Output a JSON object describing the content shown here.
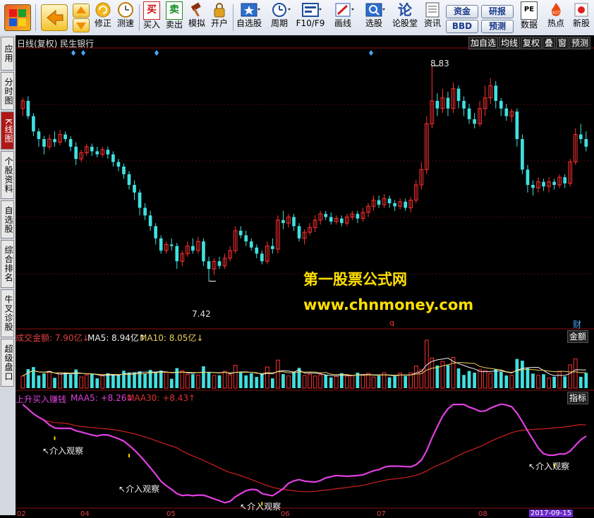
{
  "toolbar": {
    "buttons": [
      {
        "label": "修正",
        "icon": "refresh-icon"
      },
      {
        "label": "测速",
        "icon": "clock-icon"
      },
      {
        "label": "买入",
        "icon": "buy-icon"
      },
      {
        "label": "卖出",
        "icon": "sell-icon"
      },
      {
        "label": "模拟",
        "icon": "gavel-icon"
      },
      {
        "label": "开户",
        "icon": "lock-icon"
      },
      {
        "label": "自选股",
        "icon": "star-icon"
      },
      {
        "label": "周期",
        "icon": "period-icon"
      },
      {
        "label": "F10/F9",
        "icon": "f10-icon"
      },
      {
        "label": "画线",
        "icon": "pen-icon"
      },
      {
        "label": "选股",
        "icon": "screen-icon"
      },
      {
        "label": "论股堂",
        "icon": "forum-icon"
      },
      {
        "label": "资讯",
        "icon": "news-icon"
      },
      {
        "label": "数据",
        "icon": "pe-icon"
      },
      {
        "label": "热点",
        "icon": "hot-icon"
      },
      {
        "label": "新股",
        "icon": "ipo-icon"
      }
    ],
    "small_buttons": [
      "资金",
      "研报",
      "BBD",
      "预测"
    ],
    "colors": {
      "accent_red": "#b01818",
      "bg": "#000000"
    }
  },
  "sidebar": {
    "tabs": [
      "应用",
      "分时图",
      "K线图",
      "个股资料",
      "自选股",
      "综合排名",
      "牛叉诊股",
      "超级盘口"
    ],
    "active": "K线图"
  },
  "chart_header": {
    "title": "日线(复权)  民生银行",
    "right_buttons": [
      "加自选",
      "均线",
      "复权",
      "叠",
      "窗",
      "预测"
    ]
  },
  "chart_data": [
    {
      "type": "candlestick",
      "title": "日线(复权) 民生银行",
      "ylim": [
        7.2,
        8.9
      ],
      "annotations": [
        {
          "label": "8.83",
          "note": "high"
        },
        {
          "label": "7.42",
          "note": "low"
        },
        {
          "label": "财",
          "note": "finance marker"
        }
      ],
      "x_ticks": [
        "02",
        "04",
        "05",
        "06",
        "07",
        "08",
        "2017-09-15"
      ],
      "candles": [
        [
          8.55,
          8.6,
          8.62,
          8.5
        ],
        [
          8.6,
          8.5,
          8.63,
          8.48
        ],
        [
          8.5,
          8.4,
          8.52,
          8.37
        ],
        [
          8.4,
          8.35,
          8.42,
          8.3
        ],
        [
          8.35,
          8.3,
          8.37,
          8.25
        ],
        [
          8.3,
          8.35,
          8.38,
          8.28
        ],
        [
          8.35,
          8.33,
          8.4,
          8.3
        ],
        [
          8.33,
          8.38,
          8.41,
          8.31
        ],
        [
          8.38,
          8.35,
          8.4,
          8.33
        ],
        [
          8.35,
          8.3,
          8.37,
          8.27
        ],
        [
          8.3,
          8.22,
          8.33,
          8.18
        ],
        [
          8.22,
          8.26,
          8.28,
          8.2
        ],
        [
          8.26,
          8.3,
          8.32,
          8.24
        ],
        [
          8.3,
          8.27,
          8.32,
          8.24
        ],
        [
          8.27,
          8.25,
          8.3,
          8.23
        ],
        [
          8.25,
          8.28,
          8.3,
          8.23
        ],
        [
          8.28,
          8.25,
          8.3,
          8.22
        ],
        [
          8.25,
          8.2,
          8.27,
          8.17
        ],
        [
          8.2,
          8.17,
          8.22,
          8.14
        ],
        [
          8.17,
          8.12,
          8.19,
          8.09
        ],
        [
          8.12,
          8.05,
          8.14,
          8.02
        ],
        [
          8.05,
          8.0,
          8.08,
          7.95
        ],
        [
          8.0,
          7.9,
          8.02,
          7.85
        ],
        [
          7.9,
          7.85,
          7.93,
          7.82
        ],
        [
          7.85,
          7.78,
          7.88,
          7.75
        ],
        [
          7.78,
          7.7,
          7.8,
          7.66
        ],
        [
          7.7,
          7.62,
          7.72,
          7.6
        ],
        [
          7.62,
          7.66,
          7.68,
          7.6
        ],
        [
          7.66,
          7.65,
          7.7,
          7.62
        ],
        [
          7.65,
          7.55,
          7.67,
          7.5
        ],
        [
          7.55,
          7.6,
          7.62,
          7.52
        ],
        [
          7.6,
          7.65,
          7.68,
          7.58
        ],
        [
          7.65,
          7.62,
          7.7,
          7.6
        ],
        [
          7.62,
          7.68,
          7.71,
          7.6
        ],
        [
          7.68,
          7.55,
          7.7,
          7.52
        ],
        [
          7.55,
          7.5,
          7.58,
          7.42
        ],
        [
          7.5,
          7.55,
          7.57,
          7.46
        ],
        [
          7.55,
          7.52,
          7.58,
          7.5
        ],
        [
          7.52,
          7.57,
          7.6,
          7.5
        ],
        [
          7.57,
          7.62,
          7.65,
          7.55
        ],
        [
          7.62,
          7.75,
          7.78,
          7.6
        ],
        [
          7.75,
          7.72,
          7.78,
          7.7
        ],
        [
          7.72,
          7.68,
          7.75,
          7.65
        ],
        [
          7.68,
          7.64,
          7.7,
          7.62
        ],
        [
          7.64,
          7.6,
          7.66,
          7.57
        ],
        [
          7.6,
          7.55,
          7.62,
          7.53
        ],
        [
          7.55,
          7.65,
          7.68,
          7.53
        ],
        [
          7.65,
          7.63,
          7.7,
          7.6
        ],
        [
          7.63,
          7.82,
          7.85,
          7.6
        ],
        [
          7.82,
          7.8,
          7.88,
          7.76
        ],
        [
          7.8,
          7.84,
          7.86,
          7.77
        ],
        [
          7.84,
          7.78,
          7.86,
          7.75
        ],
        [
          7.78,
          7.7,
          7.8,
          7.68
        ],
        [
          7.7,
          7.74,
          7.76,
          7.66
        ],
        [
          7.74,
          7.77,
          7.8,
          7.72
        ],
        [
          7.77,
          7.82,
          7.85,
          7.74
        ],
        [
          7.82,
          7.86,
          7.88,
          7.79
        ],
        [
          7.86,
          7.84,
          7.88,
          7.82
        ],
        [
          7.84,
          7.81,
          7.87,
          7.79
        ],
        [
          7.81,
          7.83,
          7.85,
          7.79
        ],
        [
          7.83,
          7.8,
          7.85,
          7.78
        ],
        [
          7.8,
          7.84,
          7.86,
          7.78
        ],
        [
          7.84,
          7.86,
          7.88,
          7.82
        ],
        [
          7.86,
          7.83,
          7.88,
          7.8
        ],
        [
          7.83,
          7.87,
          7.9,
          7.81
        ],
        [
          7.87,
          7.91,
          7.93,
          7.84
        ],
        [
          7.91,
          7.95,
          7.98,
          7.88
        ],
        [
          7.95,
          7.92,
          7.98,
          7.9
        ],
        [
          7.92,
          7.96,
          7.99,
          7.9
        ],
        [
          7.96,
          7.93,
          7.98,
          7.9
        ],
        [
          7.93,
          7.91,
          7.95,
          7.88
        ],
        [
          7.91,
          7.94,
          7.96,
          7.89
        ],
        [
          7.94,
          7.9,
          7.96,
          7.88
        ],
        [
          7.9,
          7.95,
          7.97,
          7.87
        ],
        [
          7.95,
          8.05,
          8.08,
          7.93
        ],
        [
          8.05,
          8.15,
          8.2,
          8.02
        ],
        [
          8.15,
          8.45,
          8.5,
          8.12
        ],
        [
          8.45,
          8.6,
          8.83,
          8.42
        ],
        [
          8.6,
          8.55,
          8.65,
          8.5
        ],
        [
          8.55,
          8.62,
          8.68,
          8.52
        ],
        [
          8.62,
          8.55,
          8.66,
          8.5
        ],
        [
          8.55,
          8.68,
          8.72,
          8.52
        ],
        [
          8.68,
          8.6,
          8.7,
          8.55
        ],
        [
          8.6,
          8.55,
          8.63,
          8.5
        ],
        [
          8.55,
          8.48,
          8.58,
          8.45
        ],
        [
          8.48,
          8.45,
          8.52,
          8.42
        ],
        [
          8.45,
          8.55,
          8.6,
          8.43
        ],
        [
          8.55,
          8.62,
          8.7,
          8.5
        ],
        [
          8.62,
          8.7,
          8.75,
          8.58
        ],
        [
          8.7,
          8.6,
          8.73,
          8.55
        ],
        [
          8.6,
          8.55,
          8.62,
          8.5
        ],
        [
          8.55,
          8.5,
          8.58,
          8.47
        ],
        [
          8.5,
          8.53,
          8.55,
          8.46
        ],
        [
          8.53,
          8.35,
          8.55,
          8.3
        ],
        [
          8.35,
          8.15,
          8.38,
          8.12
        ],
        [
          8.15,
          8.05,
          8.18,
          8.0
        ],
        [
          8.05,
          8.03,
          8.08,
          7.98
        ],
        [
          8.03,
          8.07,
          8.1,
          8.0
        ],
        [
          8.07,
          8.04,
          8.09,
          8.01
        ],
        [
          8.04,
          8.07,
          8.1,
          8.0
        ],
        [
          8.07,
          8.05,
          8.09,
          8.02
        ],
        [
          8.05,
          8.1,
          8.12,
          8.03
        ],
        [
          8.1,
          8.06,
          8.12,
          8.03
        ],
        [
          8.06,
          8.2,
          8.22,
          8.04
        ],
        [
          8.2,
          8.38,
          8.42,
          8.18
        ],
        [
          8.38,
          8.35,
          8.45,
          8.32
        ],
        [
          8.35,
          8.3,
          8.4,
          8.27
        ]
      ]
    },
    {
      "type": "bar",
      "title": "成交金额",
      "unit": "亿",
      "series": [
        {
          "name": "成交金额",
          "last": "7.90亿"
        },
        {
          "name": "MA5",
          "last": "8.94亿"
        },
        {
          "name": "MA10",
          "last": "8.05亿"
        }
      ]
    },
    {
      "type": "line",
      "title": "上升买入赚钱",
      "series": [
        {
          "name": "MAA5",
          "last": "+8.26"
        },
        {
          "name": "MAA30",
          "last": "+8.43"
        }
      ],
      "annotations": [
        "介入观察",
        "介入观察",
        "介入观察",
        "介入观察"
      ]
    }
  ],
  "indicator_labels": {
    "volume_title": "成交金额: 7.90亿↓",
    "volume_ma5": "MA5: 8.94亿↑",
    "volume_ma10": "MA10: 8.05亿↓",
    "volume_right": "金额",
    "ind_title": "上升买入赚钱",
    "ind_maa5": "MAA5: +8.26↓",
    "ind_maa30": "MAA30: +8.43↑",
    "ind_right": "指标",
    "high_label": "8.83",
    "low_label": "7.42",
    "finance_marker": "财",
    "q_marker": "q",
    "signal_label": "介入观察"
  },
  "x_axis": {
    "ticks": [
      "02",
      "04",
      "05",
      "06",
      "07",
      "08"
    ],
    "date": "2017-09-15"
  },
  "watermark": {
    "line1": "第一股票公式网",
    "line2": "www.chnmoney.com"
  }
}
